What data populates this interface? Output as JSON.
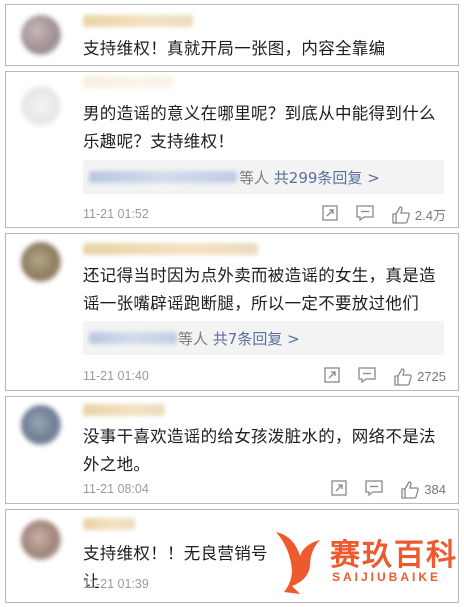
{
  "comments": [
    {
      "text": "支持维权！真就开局一张图，内容全靠编"
    },
    {
      "text": "男的造谣的意义在哪里呢？到底从中能得到什么乐趣呢？支持维权！",
      "reply_suffix": "等人",
      "reply_link": "共299条回复 >",
      "timestamp": "11-21 01:52",
      "likes": "2.4万"
    },
    {
      "text": "还记得当时因为点外卖而被造谣的女生，真是造谣一张嘴辟谣跑断腿，所以一定不要放过他们",
      "reply_suffix": "等人",
      "reply_link": "共7条回复 >",
      "timestamp": "11-21 01:40",
      "likes": "2725"
    },
    {
      "text": "没事干喜欢造谣的给女孩泼脏水的，网络不是法外之地。",
      "timestamp": "11-21 08:04",
      "likes": "384"
    },
    {
      "text": "支持维权！！无良营销号让",
      "timestamp": "11-21 01:39"
    }
  ],
  "icons": {
    "share": "share-icon",
    "comment": "comment-icon",
    "like": "thumbs-up-icon"
  },
  "watermark": {
    "cn": "赛玖百科",
    "en": "SAIJIUBAIKE"
  },
  "colors": {
    "link": "#5b6f9e",
    "watermark": "#ec5a2d",
    "reply_bg": "#f3f3f3"
  }
}
